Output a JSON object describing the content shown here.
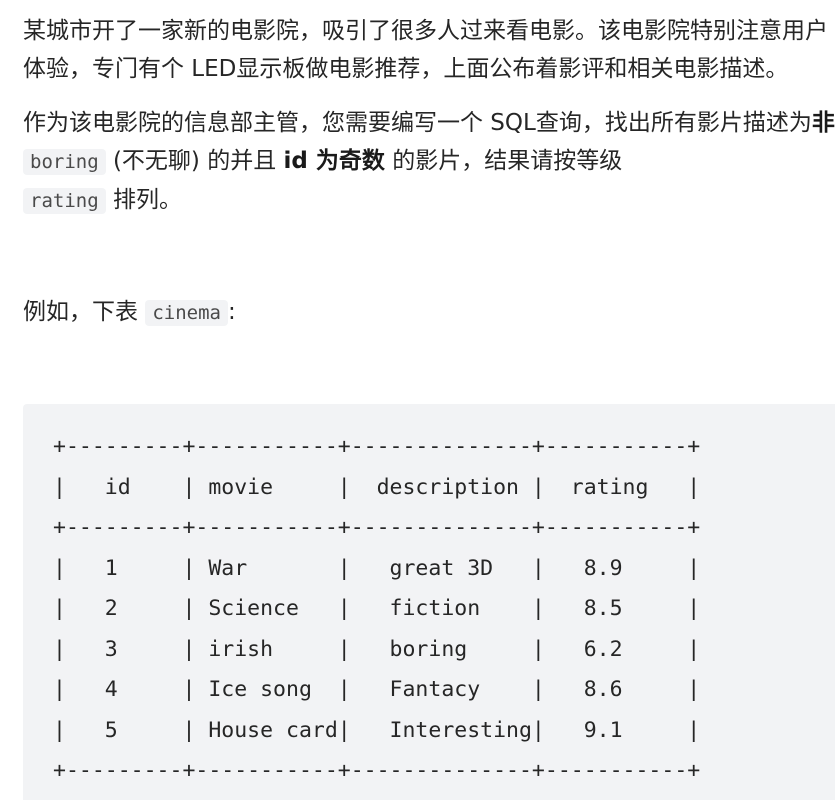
{
  "intro": {
    "p1": "某城市开了一家新的电影院，吸引了很多人过来看电影。该电影院特别注意用户体验，专门有个 LED显示板做电影推荐，上面公布着影评和相关电影描述。",
    "p2_part1": "作为该电影院的信息部主管，您需要编写一个 SQL查询，找出所有影片描述为",
    "p2_bold1": "非",
    "p2_code1": "boring",
    "p2_part2": " (不无聊) 的并且 ",
    "p2_bold2": "id 为奇数",
    "p2_part3": " 的影片，结果请按等级 ",
    "p2_code2": "rating",
    "p2_part4": " 排列。",
    "p3_part1": "例如，下表 ",
    "p3_code": "cinema",
    "p3_part2": ":"
  },
  "table_block": {
    "lines": [
      "+---------+-----------+--------------+-----------+",
      "|   id    | movie     |  description |  rating   |",
      "+---------+-----------+--------------+-----------+",
      "|   1     | War       |   great 3D   |   8.9     |",
      "|   2     | Science   |   fiction    |   8.5     |",
      "|   3     | irish     |   boring     |   6.2     |",
      "|   4     | Ice song  |   Fantacy    |   8.6     |",
      "|   5     | House card|   Interesting|   9.1     |",
      "+---------+-----------+--------------+-----------+"
    ]
  }
}
